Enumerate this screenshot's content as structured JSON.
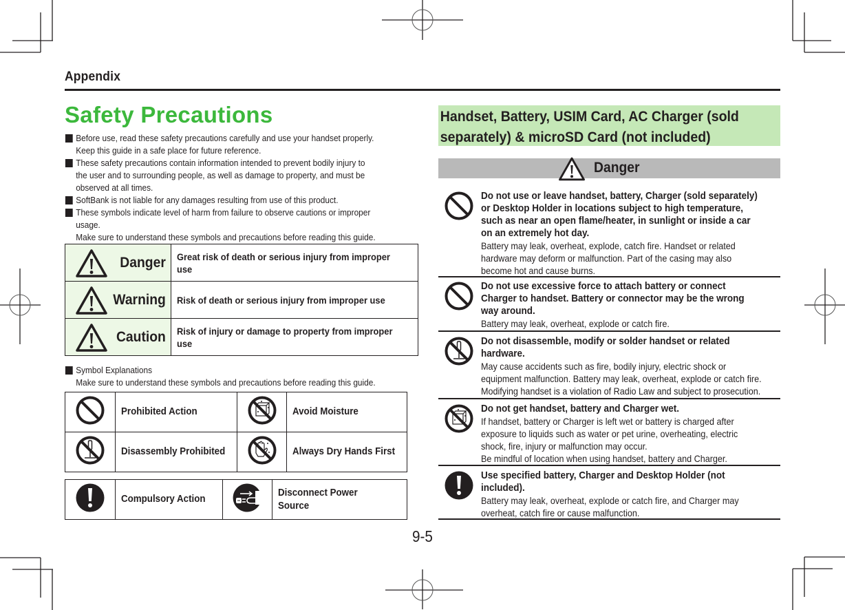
{
  "header": {
    "section": "Appendix",
    "page_number": "9-5"
  },
  "left": {
    "title": "Safety Precautions",
    "bullets": [
      {
        "lines": [
          "Before use, read these safety precautions carefully and use your handset properly.",
          "Keep this guide in a safe place for future reference."
        ]
      },
      {
        "lines": [
          "These safety precautions contain information intended to prevent bodily injury to",
          "the user and to surrounding people, as well as damage to property, and must be",
          "observed at all times."
        ]
      },
      {
        "lines": [
          "SoftBank is not liable for any damages resulting from use of this product."
        ]
      },
      {
        "lines": [
          "These symbols indicate level of harm from failure to observe cautions or improper",
          "usage.",
          "Make sure to understand these symbols and precautions before reading this guide."
        ]
      }
    ],
    "levels": [
      {
        "icon": "warning-triangle-icon",
        "name": "Danger",
        "description": "Great risk of death or serious injury from improper use"
      },
      {
        "icon": "warning-triangle-icon",
        "name": "Warning",
        "description": "Risk of death or serious injury from improper use"
      },
      {
        "icon": "warning-triangle-icon",
        "name": "Caution",
        "description": "Risk of injury or damage to property from improper use"
      }
    ],
    "symbol_note": {
      "title": "Symbol Explanations",
      "text": "Make sure to understand these symbols and precautions before reading this guide."
    },
    "symbols": [
      {
        "icon": "prohibited-icon",
        "label": "Prohibited Action"
      },
      {
        "icon": "avoid-moisture-icon",
        "label": "Avoid Moisture"
      },
      {
        "icon": "disassembly-prohibited-icon",
        "label": "Disassembly Prohibited"
      },
      {
        "icon": "dry-hands-icon",
        "label": "Always Dry Hands First"
      },
      {
        "icon": "compulsory-action-icon",
        "label": "Compulsory Action"
      },
      {
        "icon": "disconnect-power-icon",
        "label": "Disconnect Power Source"
      }
    ]
  },
  "right": {
    "section_title_lines": [
      "Handset, Battery, USIM Card, AC Charger (sold",
      "separately) & microSD Card (not included)"
    ],
    "danger_label": "Danger",
    "items": [
      {
        "icon": "prohibited-icon",
        "head": [
          "Do not use or leave handset, battery, Charger (sold separately)",
          "or Desktop Holder in locations subject to high temperature,",
          "such as near an open flame/heater, in sunlight or inside a car",
          "on an extremely hot day."
        ],
        "body": [
          "Battery may leak, overheat, explode, catch fire. Handset or related",
          "hardware may deform or malfunction. Part of the casing may also",
          "become hot and cause burns."
        ]
      },
      {
        "icon": "prohibited-icon",
        "head": [
          "Do not use excessive force to attach battery or connect",
          "Charger to handset. Battery or connector may be the wrong",
          "way around."
        ],
        "body": [
          "Battery may leak, overheat, explode or catch fire."
        ]
      },
      {
        "icon": "disassembly-prohibited-icon",
        "head": [
          "Do not disassemble, modify or solder handset or related",
          "hardware."
        ],
        "body": [
          "May cause accidents such as fire, bodily injury, electric shock or",
          "equipment malfunction. Battery may leak, overheat, explode or catch fire.",
          "Modifying handset is a violation of Radio Law and subject to prosecution."
        ]
      },
      {
        "icon": "avoid-moisture-icon",
        "head": [
          "Do not get handset, battery and Charger wet."
        ],
        "body": [
          "If handset, battery or Charger is left wet or battery is charged after",
          "exposure to liquids such as water or pet urine, overheating, electric",
          "shock, fire, injury or malfunction may occur.",
          "Be mindful of location when using handset, battery and Charger."
        ]
      },
      {
        "icon": "compulsory-action-icon",
        "head": [
          "Use specified battery, Charger and Desktop Holder (not",
          "included)."
        ],
        "body": [
          "Battery may leak, overheat, explode or catch fire, and Charger may",
          "overheat, catch fire or cause malfunction."
        ]
      }
    ]
  },
  "colors": {
    "title_green": "#3cb83c",
    "section_green_bg": "#c5e8b7",
    "level_cell_bg": "#edf8e6",
    "danger_bar_bg": "#b9b9b9",
    "text": "#231f20"
  }
}
